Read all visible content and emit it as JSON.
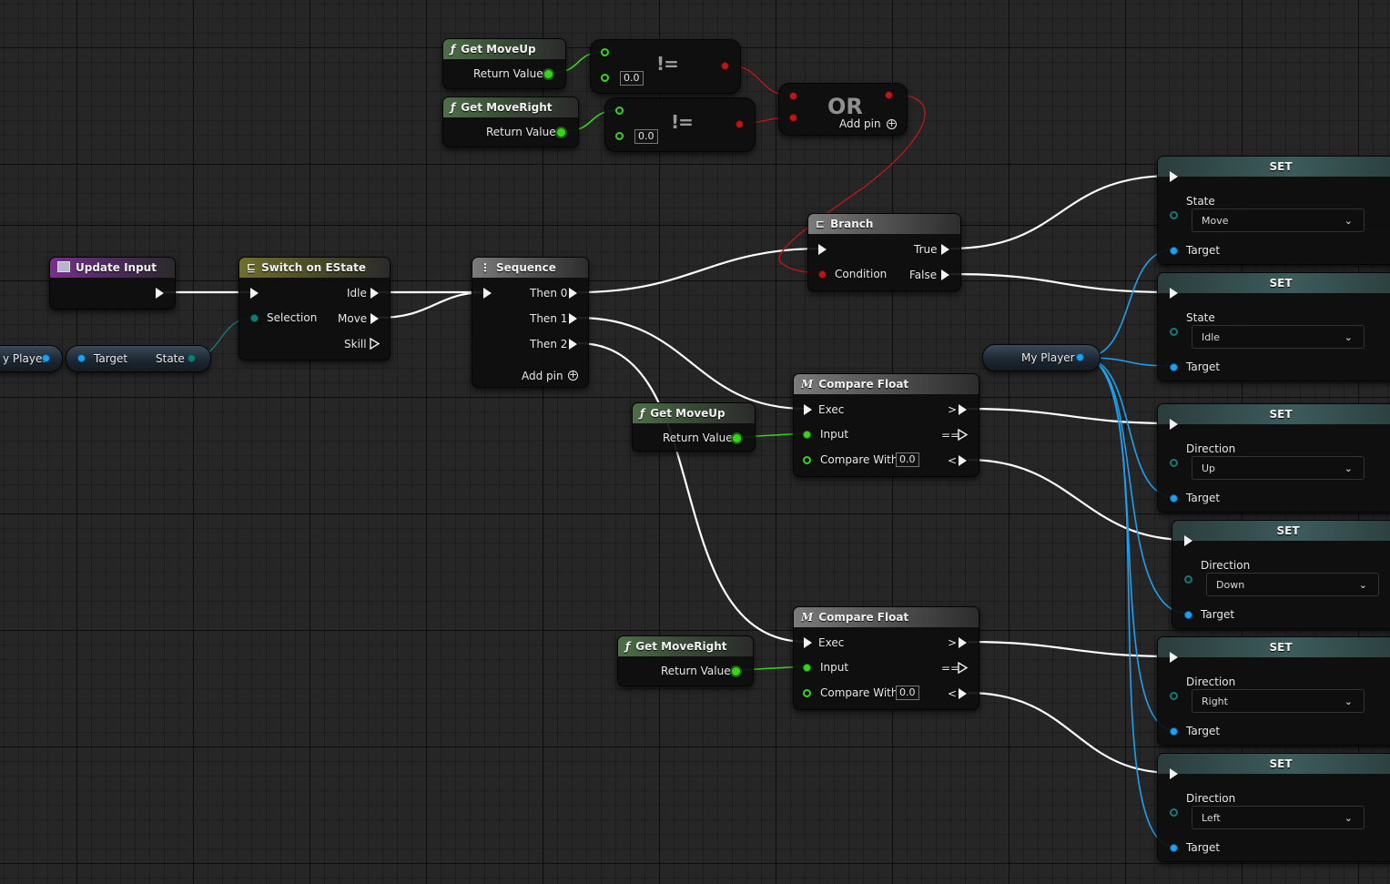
{
  "graph": {
    "get_moveup_top": {
      "title": "Get MoveUp",
      "icon": "function-icon",
      "out_label": "Return Value"
    },
    "get_moveright_top": {
      "title": "Get MoveRight",
      "icon": "function-icon",
      "out_label": "Return Value"
    },
    "neq_1": {
      "symbol": "!=",
      "default_value": "0.0"
    },
    "neq_2": {
      "symbol": "!=",
      "default_value": "0.0"
    },
    "or_node": {
      "title": "OR",
      "add_pin_label": "Add pin"
    },
    "update_input": {
      "title": "Update Input",
      "icon": "event-icon"
    },
    "my_player_left": {
      "label": "y Player"
    },
    "state_getter": {
      "target_label": "Target",
      "state_label": "State"
    },
    "switch_estate": {
      "title": "Switch on EState",
      "selection_label": "Selection",
      "outputs": [
        "Idle",
        "Move",
        "Skill"
      ]
    },
    "sequence": {
      "title": "Sequence",
      "outputs": [
        "Then 0",
        "Then 1",
        "Then 2"
      ],
      "add_pin_label": "Add pin"
    },
    "branch": {
      "title": "Branch",
      "condition_label": "Condition",
      "true_label": "True",
      "false_label": "False"
    },
    "get_moveup_mid": {
      "title": "Get MoveUp",
      "out_label": "Return Value"
    },
    "get_moveright_bottom": {
      "title": "Get MoveRight",
      "out_label": "Return Value"
    },
    "compare_float_1": {
      "title": "Compare Float",
      "exec_label": "Exec",
      "input_label": "Input",
      "compare_label": "Compare With",
      "compare_value": "0.0",
      "ops": [
        ">",
        "==",
        "<"
      ]
    },
    "compare_float_2": {
      "title": "Compare Float",
      "exec_label": "Exec",
      "input_label": "Input",
      "compare_label": "Compare With",
      "compare_value": "0.0",
      "ops": [
        ">",
        "==",
        "<"
      ]
    },
    "my_player_right": {
      "label": "My Player"
    },
    "set_nodes": [
      {
        "title": "SET",
        "field_label": "State",
        "value": "Move",
        "target_label": "Target"
      },
      {
        "title": "SET",
        "field_label": "State",
        "value": "Idle",
        "target_label": "Target"
      },
      {
        "title": "SET",
        "field_label": "Direction",
        "value": "Up",
        "target_label": "Target"
      },
      {
        "title": "SET",
        "field_label": "Direction",
        "value": "Down",
        "target_label": "Target"
      },
      {
        "title": "SET",
        "field_label": "Direction",
        "value": "Right",
        "target_label": "Target"
      },
      {
        "title": "SET",
        "field_label": "Direction",
        "value": "Left",
        "target_label": "Target"
      }
    ]
  },
  "colors": {
    "background": "#262626",
    "exec_wire": "#ffffff",
    "float_wire": "#39d31e",
    "object_wire": "#1ea0f0",
    "bool_wire": "#b81818",
    "enum_wire": "#117c77",
    "function_header": "#4d6e47",
    "event_header": "#7a2f8f",
    "switch_header": "#70702d",
    "set_header": "#3c5b5b"
  }
}
